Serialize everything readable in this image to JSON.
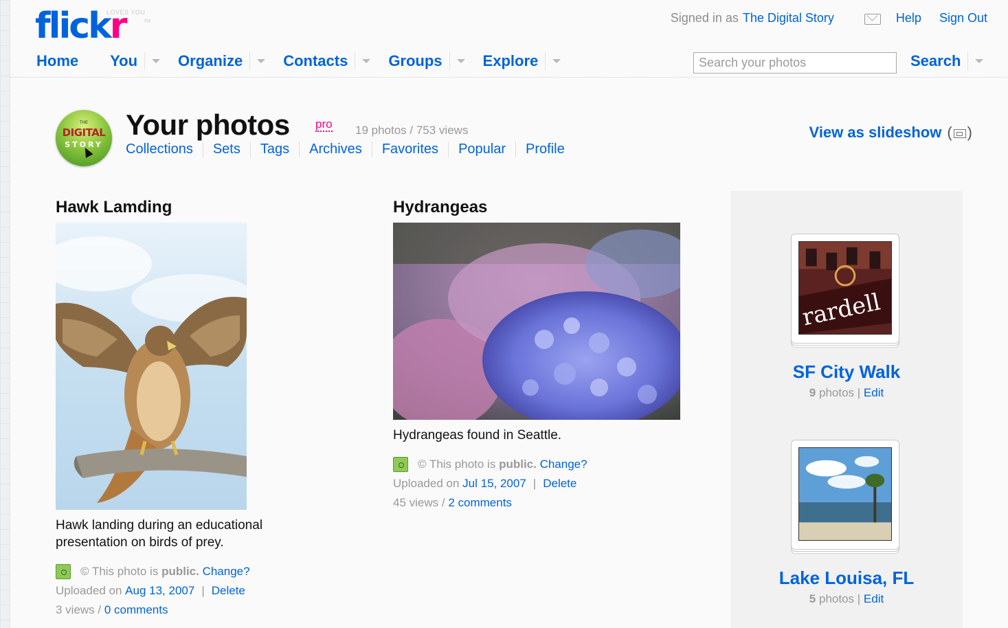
{
  "logo": {
    "word_main": "flick",
    "word_accent": "r",
    "tagline": "LOVES YOU",
    "tm": "TM"
  },
  "account": {
    "signed_in_label": "Signed in as",
    "user_name": "The Digital Story",
    "help": "Help",
    "sign_out": "Sign Out"
  },
  "nav": {
    "home": "Home",
    "you": "You",
    "organize": "Organize",
    "contacts": "Contacts",
    "groups": "Groups",
    "explore": "Explore"
  },
  "search": {
    "placeholder": "Search your photos",
    "button": "Search"
  },
  "header": {
    "avatar_top": "THE",
    "avatar_line1": "DIGITAL",
    "avatar_line2": "STORY",
    "title": "Your photos",
    "pro": "pro",
    "stats": "19 photos / 753 views",
    "subnav": [
      "Collections",
      "Sets",
      "Tags",
      "Archives",
      "Favorites",
      "Popular",
      "Profile"
    ],
    "slideshow": "View as slideshow",
    "slideshow_open": "(",
    "slideshow_close": ")"
  },
  "photos": [
    {
      "title": "Hawk Lamding",
      "description": "Hawk landing during an educational presentation on birds of prey.",
      "privacy_prefix": "© This photo is",
      "privacy_value": "public.",
      "change": "Change?",
      "uploaded_prefix": "Uploaded on",
      "uploaded_date": "Aug 13, 2007",
      "delete": "Delete",
      "views": "3 views /",
      "comments": "0 comments"
    },
    {
      "title": "Hydrangeas",
      "description": "Hydrangeas found in Seattle.",
      "privacy_prefix": "© This photo is",
      "privacy_value": "public.",
      "change": "Change?",
      "uploaded_prefix": "Uploaded on",
      "uploaded_date": "Jul 15, 2007",
      "delete": "Delete",
      "views": "45 views /",
      "comments": "2 comments"
    }
  ],
  "sets": [
    {
      "name": "SF City Walk",
      "count": "9",
      "count_label": "photos",
      "edit": "Edit",
      "sign_text": "rardell"
    },
    {
      "name": "Lake Louisa, FL",
      "count": "5",
      "count_label": "photos",
      "edit": "Edit"
    }
  ],
  "colors": {
    "link": "#0063dc",
    "brand_pink": "#ff0084",
    "muted": "#999999"
  }
}
